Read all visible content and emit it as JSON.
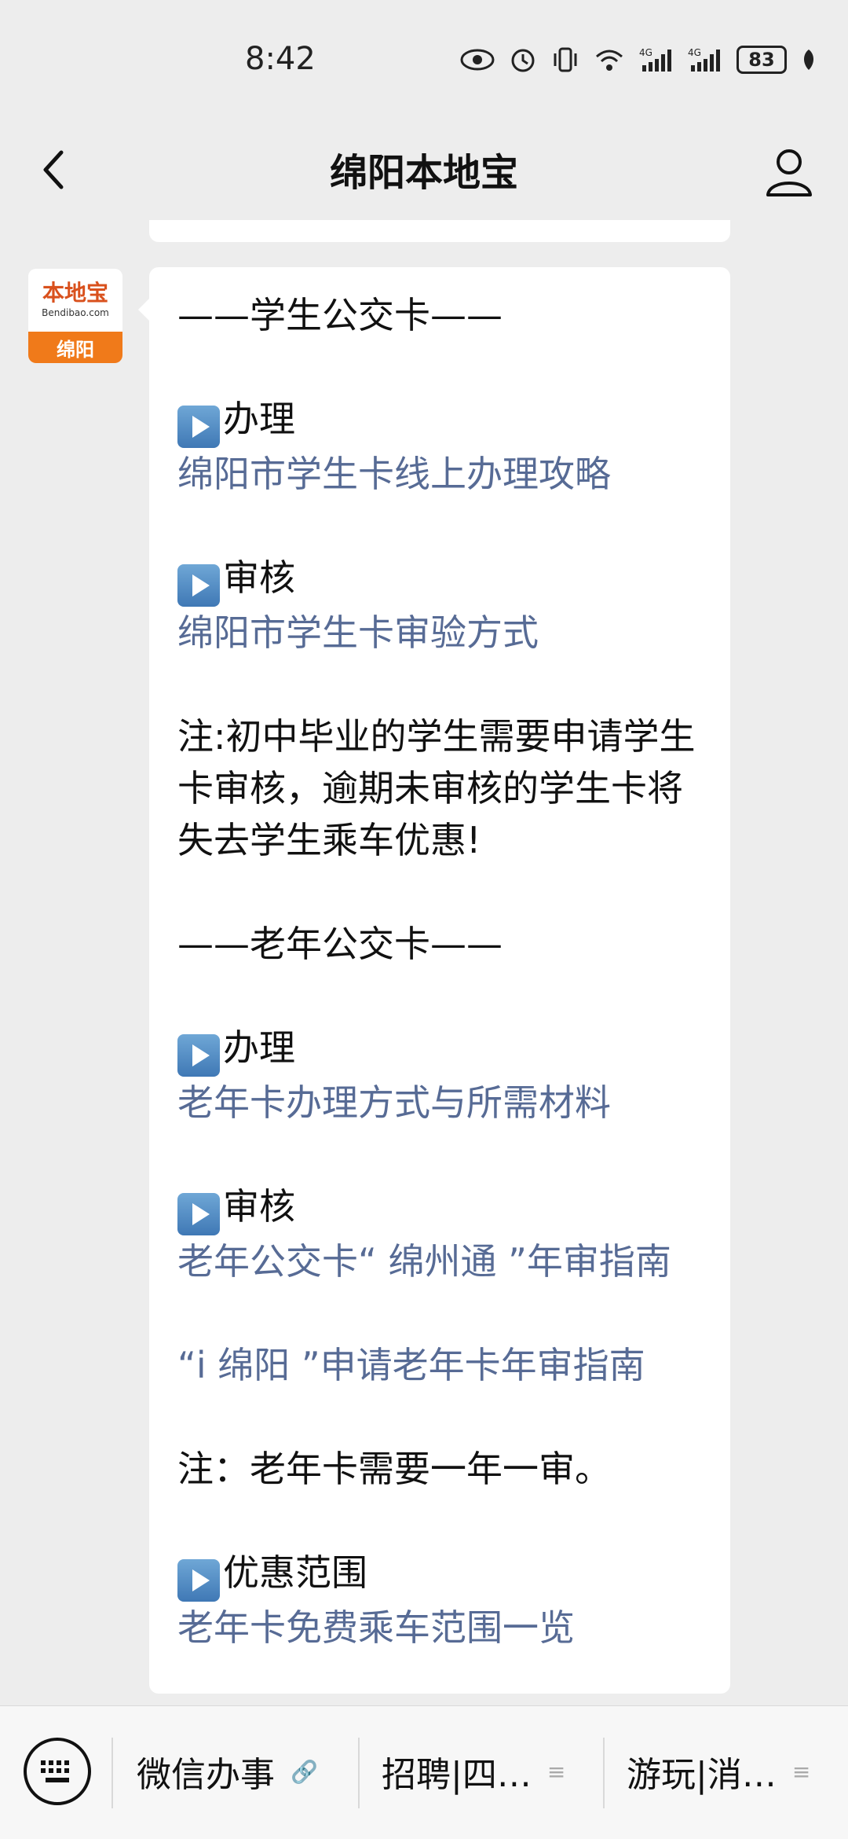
{
  "status": {
    "time": "8:42",
    "battery": "83",
    "icons": [
      "eye-icon",
      "alarm-icon",
      "vibrate-icon",
      "wifi-icon",
      "signal-4g-icon",
      "signal-4g-icon"
    ]
  },
  "nav": {
    "title": "绵阳本地宝"
  },
  "avatar": {
    "brand": "本地宝",
    "sub": "Bendibao.com",
    "city": "绵阳"
  },
  "message": {
    "student_header": "——学生公交卡——",
    "student_apply_label": "办理",
    "student_apply_link": "绵阳市学生卡线上办理攻略",
    "student_review_label": "审核",
    "student_review_link": "绵阳市学生卡审验方式",
    "student_note": "注:初中毕业的学生需要申请学生卡审核，逾期未审核的学生卡将失去学生乘车优惠!",
    "elder_header": "——老年公交卡——",
    "elder_apply_label": "办理",
    "elder_apply_link": "老年卡办理方式与所需材料",
    "elder_review_label": "审核",
    "elder_review_link1": "老年公交卡“ 绵州通 ”年审指南",
    "elder_review_link2": "“i 绵阳 ”申请老年卡年审指南",
    "elder_note": "注：老年卡需要一年一审。",
    "elder_benefit_label": "优惠范围",
    "elder_benefit_link": "老年卡免费乘车范围一览"
  },
  "bottom_menu": {
    "item1": "微信办事",
    "item2": "招聘|四…",
    "item3": "游玩|消…"
  }
}
